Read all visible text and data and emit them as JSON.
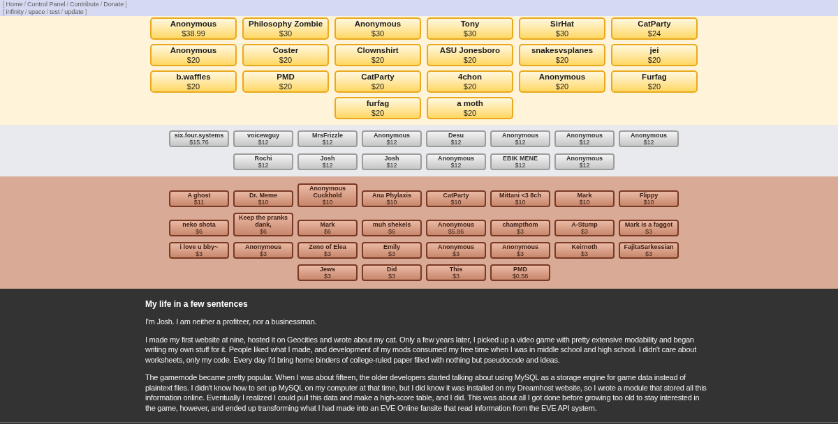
{
  "nav": [
    [
      {
        "kind": "bracket",
        "text": "["
      },
      {
        "kind": "link",
        "text": "Home"
      },
      {
        "kind": "separator",
        "text": "/"
      },
      {
        "kind": "link",
        "text": "Control Panel"
      },
      {
        "kind": "separator",
        "text": "/"
      },
      {
        "kind": "link",
        "text": "Contribute"
      },
      {
        "kind": "separator",
        "text": "/"
      },
      {
        "kind": "link",
        "text": "Donate"
      },
      {
        "kind": "bracket",
        "text": "]"
      }
    ],
    [
      {
        "kind": "bracket",
        "text": "["
      },
      {
        "kind": "link",
        "text": "infinity"
      },
      {
        "kind": "separator",
        "text": "/"
      },
      {
        "kind": "link",
        "text": "space"
      },
      {
        "kind": "separator",
        "text": "/"
      },
      {
        "kind": "link",
        "text": "test"
      },
      {
        "kind": "separator",
        "text": "/"
      },
      {
        "kind": "link",
        "text": "update"
      },
      {
        "kind": "bracket",
        "text": "]"
      }
    ]
  ],
  "tiers": [
    {
      "kind": "gold",
      "donors": [
        {
          "name": "Anonymous",
          "amount": "$38.99"
        },
        {
          "name": "Philosophy Zombie",
          "amount": "$30"
        },
        {
          "name": "Anonymous",
          "amount": "$30"
        },
        {
          "name": "Tony",
          "amount": "$30"
        },
        {
          "name": "SirHat",
          "amount": "$30"
        },
        {
          "name": "CatParty",
          "amount": "$24"
        },
        {
          "name": "Anonymous",
          "amount": "$20"
        },
        {
          "name": "Coster",
          "amount": "$20"
        },
        {
          "name": "Clownshirt",
          "amount": "$20"
        },
        {
          "name": "ASU Jonesboro",
          "amount": "$20"
        },
        {
          "name": "snakesvsplanes",
          "amount": "$20"
        },
        {
          "name": "jei",
          "amount": "$20"
        },
        {
          "name": "b.waffles",
          "amount": "$20"
        },
        {
          "name": "PMD",
          "amount": "$20"
        },
        {
          "name": "CatParty",
          "amount": "$20"
        },
        {
          "name": "4chon",
          "amount": "$20"
        },
        {
          "name": "Anonymous",
          "amount": "$20"
        },
        {
          "name": "Furfag",
          "amount": "$20"
        },
        {
          "name": "furfag",
          "amount": "$20"
        },
        {
          "name": "a moth",
          "amount": "$20"
        }
      ]
    },
    {
      "kind": "silver",
      "donors": [
        {
          "name": "six.four.systems",
          "amount": "$15.76"
        },
        {
          "name": "voicewguy",
          "amount": "$12"
        },
        {
          "name": "MrsFrizzle",
          "amount": "$12"
        },
        {
          "name": "Anonymous",
          "amount": "$12"
        },
        {
          "name": "Desu",
          "amount": "$12"
        },
        {
          "name": "Anonymous",
          "amount": "$12"
        },
        {
          "name": "Anonymous",
          "amount": "$12"
        },
        {
          "name": "Anonymous",
          "amount": "$12"
        },
        {
          "name": "Rochi",
          "amount": "$12"
        },
        {
          "name": "Josh",
          "amount": "$12"
        },
        {
          "name": "Josh",
          "amount": "$12"
        },
        {
          "name": "Anonymous",
          "amount": "$12"
        },
        {
          "name": "EBIK MENE",
          "amount": "$12"
        },
        {
          "name": "Anonymous",
          "amount": "$12"
        }
      ]
    },
    {
      "kind": "bronze",
      "donors": [
        {
          "name": "A ghost",
          "amount": "$11"
        },
        {
          "name": "Dr. Meme",
          "amount": "$10"
        },
        {
          "name": "Anonymous Cuckhold",
          "amount": "$10"
        },
        {
          "name": "Ana Phylaxis",
          "amount": "$10"
        },
        {
          "name": "CatParty",
          "amount": "$10"
        },
        {
          "name": "Mittani <3 8ch",
          "amount": "$10"
        },
        {
          "name": "Mark",
          "amount": "$10"
        },
        {
          "name": "Flippy",
          "amount": "$10"
        },
        {
          "name": "neko shota",
          "amount": "$6"
        },
        {
          "name": "Keep the pranks dank,",
          "amount": "$6"
        },
        {
          "name": "Mark",
          "amount": "$6"
        },
        {
          "name": "muh shekels",
          "amount": "$6"
        },
        {
          "name": "Anonymous",
          "amount": "$5.86"
        },
        {
          "name": "champthom",
          "amount": "$3"
        },
        {
          "name": "A-Stump",
          "amount": "$3"
        },
        {
          "name": "Mark is a faggot",
          "amount": "$3"
        },
        {
          "name": "i love u bby~",
          "amount": "$3"
        },
        {
          "name": "Anonymous",
          "amount": "$3"
        },
        {
          "name": "Zeno of Elea",
          "amount": "$3"
        },
        {
          "name": "Emily",
          "amount": "$3"
        },
        {
          "name": "Anonymous",
          "amount": "$3"
        },
        {
          "name": "Anonymous",
          "amount": "$3"
        },
        {
          "name": "Keirnoth",
          "amount": "$3"
        },
        {
          "name": "FajitaSarkessian",
          "amount": "$3"
        },
        {
          "name": "Jews",
          "amount": "$3"
        },
        {
          "name": "Did",
          "amount": "$3"
        },
        {
          "name": "This",
          "amount": "$3"
        },
        {
          "name": "PMD",
          "amount": "$0.58"
        }
      ]
    }
  ],
  "about": {
    "heading": "My life in a few sentences",
    "paragraphs": [
      "I'm Josh. I am neither a profiteer, nor a businessman.",
      "I made my first website at nine, hosted it on Geocities and wrote about my cat. Only a few years later, I picked up a video game with pretty extensive modability and began writing my own stuff for it. People liked what I made, and development of my mods consumed my free time when I was in middle school and high school. I didn't care about worksheets, only my code. Every day I'd bring home binders of college-ruled paper filled with nothing but pseudocode and ideas.",
      "The gamemode became pretty popular. When I was about fifteen, the older developers started talking about using MySQL as a storage engine for game data instead of plaintext files. I didn't know how to set up MySQL on my computer at that time, but I did know it was installed on my Dreamhost website, so I wrote a module that stored all this information online. Eventually I realized I could pull this data and make a high-score table, and I did. This was about all I got done before growing too old to stay interested in the game, however, and ended up transforming what I had made into an EVE Online fansite that read information from the EVE API system."
    ]
  }
}
